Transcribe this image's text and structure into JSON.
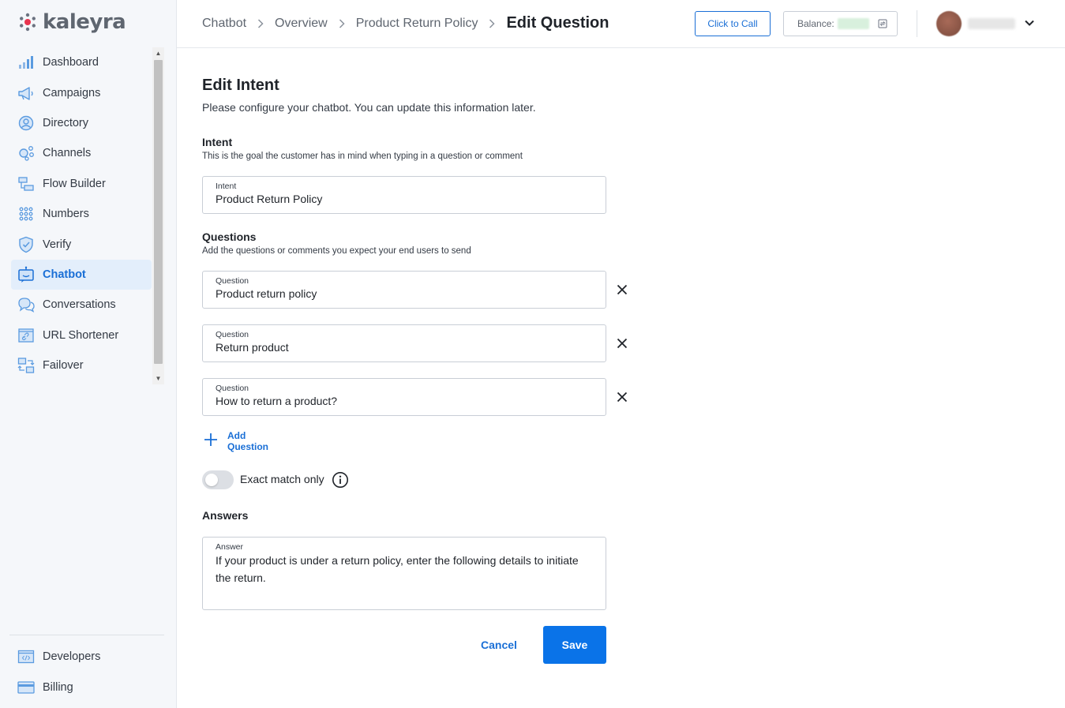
{
  "app": {
    "brand": "kaleyra"
  },
  "sidebar": {
    "items": [
      {
        "label": "Dashboard",
        "icon": "dashboard-icon"
      },
      {
        "label": "Campaigns",
        "icon": "megaphone-icon"
      },
      {
        "label": "Directory",
        "icon": "contact-icon"
      },
      {
        "label": "Channels",
        "icon": "channels-icon"
      },
      {
        "label": "Flow Builder",
        "icon": "flow-icon"
      },
      {
        "label": "Numbers",
        "icon": "keypad-icon"
      },
      {
        "label": "Verify",
        "icon": "shield-check-icon"
      },
      {
        "label": "Chatbot",
        "icon": "chatbot-icon",
        "active": true
      },
      {
        "label": "Conversations",
        "icon": "chat-bubbles-icon"
      },
      {
        "label": "URL Shortener",
        "icon": "link-icon"
      },
      {
        "label": "Failover",
        "icon": "failover-icon"
      }
    ],
    "bottom_items": [
      {
        "label": "Developers",
        "icon": "code-icon"
      },
      {
        "label": "Billing",
        "icon": "card-icon"
      }
    ]
  },
  "header": {
    "breadcrumb": [
      "Chatbot",
      "Overview",
      "Product Return Policy",
      "Edit Question"
    ],
    "click_to_call": "Click to Call",
    "balance_label": "Balance:"
  },
  "form": {
    "title": "Edit Intent",
    "description": "Please configure your chatbot. You can update this information later.",
    "intent_section": {
      "title": "Intent",
      "description": "This is the goal the customer has in mind when typing in a question or comment",
      "field_label": "Intent",
      "value": "Product Return Policy"
    },
    "questions_section": {
      "title": "Questions",
      "description": "Add the questions or comments you expect your end users to send",
      "items": [
        {
          "label": "Question",
          "value": "Product return policy"
        },
        {
          "label": "Question",
          "value": "Return product"
        },
        {
          "label": "Question",
          "value": "How to return a product?"
        }
      ],
      "add_label": "Add Question"
    },
    "exact_match": {
      "label": "Exact match only",
      "enabled": false
    },
    "answers_section": {
      "title": "Answers",
      "field_label": "Answer",
      "value": "If your product is under a return policy, enter the following details to initiate the return."
    },
    "cancel_label": "Cancel",
    "save_label": "Save"
  },
  "colors": {
    "accent": "#1a6fd6",
    "primary_button": "#0a73e8",
    "logo_red": "#e8344e",
    "sidebar_bg": "#f5f7fa",
    "active_bg": "#e3eefb"
  }
}
